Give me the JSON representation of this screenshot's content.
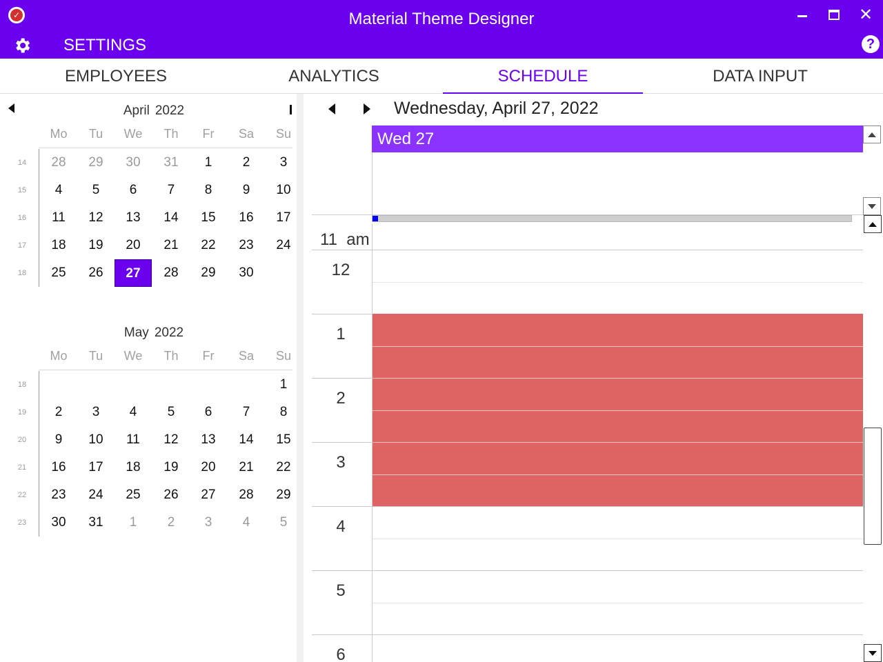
{
  "window": {
    "title": "Material Theme Designer"
  },
  "toolbar": {
    "settings_label": "SETTINGS"
  },
  "tabs": [
    {
      "label": "EMPLOYEES",
      "active": false
    },
    {
      "label": "ANALYTICS",
      "active": false
    },
    {
      "label": "SCHEDULE",
      "active": true
    },
    {
      "label": "DATA INPUT",
      "active": false
    }
  ],
  "calendar": {
    "day_names": [
      "Mo",
      "Tu",
      "We",
      "Th",
      "Fr",
      "Sa",
      "Su"
    ],
    "months": [
      {
        "name": "April",
        "year": "2022",
        "weeks": [
          {
            "num": "14",
            "days": [
              "28",
              "29",
              "30",
              "31",
              "1",
              "2",
              "3"
            ]
          },
          {
            "num": "15",
            "days": [
              "4",
              "5",
              "6",
              "7",
              "8",
              "9",
              "10"
            ]
          },
          {
            "num": "16",
            "days": [
              "11",
              "12",
              "13",
              "14",
              "15",
              "16",
              "17"
            ]
          },
          {
            "num": "17",
            "days": [
              "18",
              "19",
              "20",
              "21",
              "22",
              "23",
              "24"
            ]
          },
          {
            "num": "18",
            "days": [
              "25",
              "26",
              "27",
              "28",
              "29",
              "30",
              ""
            ]
          }
        ],
        "selected_day": "27"
      },
      {
        "name": "May",
        "year": "2022",
        "weeks": [
          {
            "num": "18",
            "days": [
              "",
              "",
              "",
              "",
              "",
              "",
              "1"
            ]
          },
          {
            "num": "19",
            "days": [
              "2",
              "3",
              "4",
              "5",
              "6",
              "7",
              "8"
            ]
          },
          {
            "num": "20",
            "days": [
              "9",
              "10",
              "11",
              "12",
              "13",
              "14",
              "15"
            ]
          },
          {
            "num": "21",
            "days": [
              "16",
              "17",
              "18",
              "19",
              "20",
              "21",
              "22"
            ]
          },
          {
            "num": "22",
            "days": [
              "23",
              "24",
              "25",
              "26",
              "27",
              "28",
              "29"
            ]
          },
          {
            "num": "23",
            "days": [
              "30",
              "31",
              "1",
              "2",
              "3",
              "4",
              "5"
            ]
          }
        ],
        "trailing_days": [
          "1",
          "2",
          "3",
          "4",
          "5"
        ]
      }
    ]
  },
  "schedule": {
    "date_label": "Wednesday, April 27, 2022",
    "day_header": "Wed 27",
    "hours": [
      "11  am",
      "12",
      "1",
      "2",
      "3",
      "4",
      "5",
      "6"
    ],
    "appointment": {
      "start_hour": "1",
      "end_hour": "4",
      "color": "#DE6464"
    }
  },
  "colors": {
    "accent": "#6A00EE",
    "day_header": "#8A33FF",
    "appointment": "#DE6464"
  }
}
